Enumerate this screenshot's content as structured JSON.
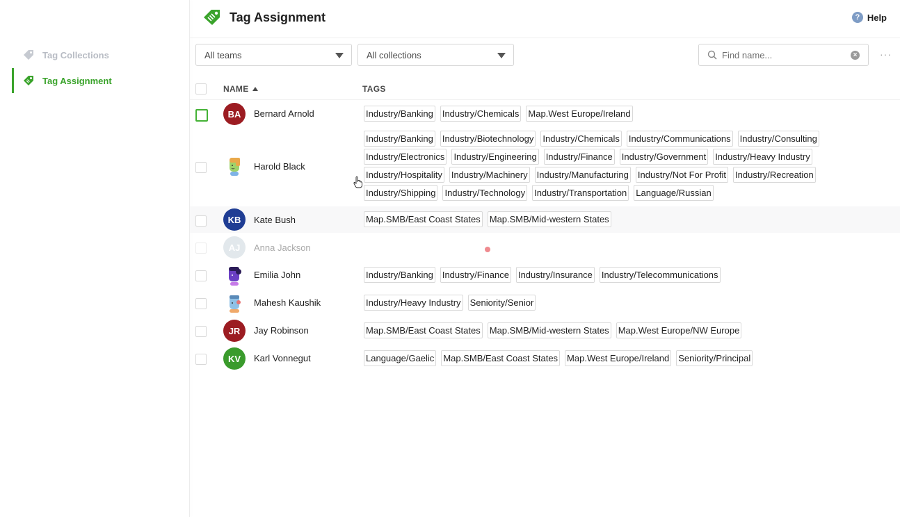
{
  "sidebar": {
    "items": [
      {
        "label": "Tag Collections"
      },
      {
        "label": "Tag Assignment"
      }
    ]
  },
  "header": {
    "title": "Tag Assignment",
    "help_label": "Help",
    "help_glyph": "?"
  },
  "filters": {
    "teams": "All teams",
    "collections": "All collections",
    "search_placeholder": "Find name...",
    "more": "···"
  },
  "table": {
    "col_name": "NAME",
    "col_tags": "TAGS",
    "rows": [
      {
        "initials": "BA",
        "name": "Bernard Arnold",
        "avatar_color": "#9c1c22",
        "tags": [
          "Industry/Banking",
          "Industry/Chemicals",
          "Map.West Europe/Ireland"
        ]
      },
      {
        "initials": "",
        "name": "Harold Black",
        "avatar_icon": "cartoon-avatar-icon",
        "tags": [
          "Industry/Banking",
          "Industry/Biotechnology",
          "Industry/Chemicals",
          "Industry/Communications",
          "Industry/Consulting",
          "Industry/Electronics",
          "Industry/Engineering",
          "Industry/Finance",
          "Industry/Government",
          "Industry/Heavy Industry",
          "Industry/Hospitality",
          "Industry/Machinery",
          "Industry/Manufacturing",
          "Industry/Not For Profit",
          "Industry/Recreation",
          "Industry/Shipping",
          "Industry/Technology",
          "Industry/Transportation",
          "Language/Russian"
        ]
      },
      {
        "initials": "KB",
        "name": "Kate Bush",
        "avatar_color": "#1f3d94",
        "tags": [
          "Map.SMB/East Coast States",
          "Map.SMB/Mid-western States"
        ]
      },
      {
        "initials": "AJ",
        "name": "Anna Jackson",
        "avatar_color": "#e2e8ec",
        "tags": []
      },
      {
        "initials": "",
        "name": "Emilia John",
        "avatar_icon": "cartoon-avatar-icon",
        "tags": [
          "Industry/Banking",
          "Industry/Finance",
          "Industry/Insurance",
          "Industry/Telecommunications"
        ]
      },
      {
        "initials": "",
        "name": "Mahesh Kaushik",
        "avatar_icon": "cartoon-avatar-icon",
        "tags": [
          "Industry/Heavy Industry",
          "Seniority/Senior"
        ]
      },
      {
        "initials": "JR",
        "name": "Jay Robinson",
        "avatar_color": "#9c1c22",
        "tags": [
          "Map.SMB/East Coast States",
          "Map.SMB/Mid-western States",
          "Map.West Europe/NW Europe"
        ]
      },
      {
        "initials": "KV",
        "name": "Karl Vonnegut",
        "avatar_color": "#3a9b2c",
        "tags": [
          "Language/Gaelic",
          "Map.SMB/East Coast States",
          "Map.West Europe/Ireland",
          "Seniority/Principal"
        ]
      }
    ]
  },
  "colors": {
    "accent": "#3aa32b",
    "inactive_nav": "#b8bcc4"
  }
}
